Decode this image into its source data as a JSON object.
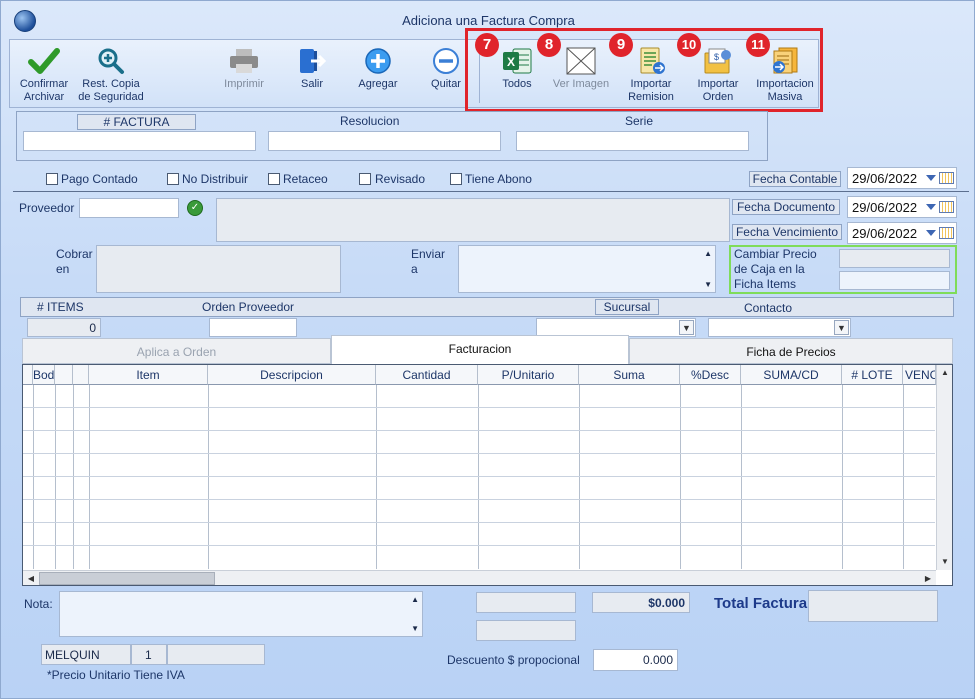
{
  "window": {
    "title": "Adiciona una Factura Compra"
  },
  "toolbar": {
    "confirm": "Confirmar\nArchivar",
    "restore": "Rest. Copia\nde Seguridad",
    "print": "Imprimir",
    "exit": "Salir",
    "add": "Agregar",
    "remove": "Quitar",
    "excel": "Todos",
    "image": "Ver Imagen",
    "import_remision": "Importar\nRemision",
    "import_orden": "Importar\nOrden",
    "import_masiva": "Importacion\nMasiva",
    "badges": [
      "7",
      "8",
      "9",
      "10",
      "11"
    ],
    "highlight_color": "#e0242b"
  },
  "header": {
    "factura_label": "# FACTURA",
    "resolucion_label": "Resolucion",
    "serie_label": "Serie",
    "factura_value": "",
    "resolucion_value": "",
    "serie_value": ""
  },
  "checks": {
    "pago_contado": "Pago Contado",
    "no_distribuir": "No Distribuir",
    "retaceo": "Retaceo",
    "revisado": "Revisado",
    "tiene_abono": "Tiene Abono"
  },
  "dates": {
    "contable_label": "Fecha Contable",
    "contable_value": "29/06/2022",
    "documento_label": "Fecha Documento",
    "documento_value": "29/06/2022",
    "vencimiento_label": "Fecha Vencimiento",
    "vencimiento_value": "29/06/2022"
  },
  "proveedor": {
    "label": "Proveedor",
    "value": ""
  },
  "cobrar_label": "Cobrar\nen",
  "enviar_label": "Enviar\na",
  "cambiar_precio_label": "Cambiar Precio\nde Caja en la\nFicha Items",
  "info": {
    "items_label": "# ITEMS",
    "items_value": "0",
    "orden_label": "Orden Proveedor",
    "sucursal_label": "Sucursal",
    "contacto_label": "Contacto"
  },
  "tabs": [
    "Aplica a Orden",
    "Facturacion",
    "Ficha de Precios"
  ],
  "grid": {
    "columns": [
      "Bodega",
      "",
      "",
      "Item",
      "Descripcion",
      "Cantidad",
      "P/Unitario",
      "Suma",
      "%Desc",
      "SUMA/CD",
      "# LOTE",
      "VENCE"
    ],
    "rows": []
  },
  "footer": {
    "nota_label": "Nota:",
    "total_value": "$0.000",
    "total_label": "Total Factura",
    "user": "MELQUIN",
    "user_num": "1",
    "descuento_label": "Descuento $ propocional",
    "descuento_value": "0.000",
    "iva_note": "*Precio Unitario Tiene IVA"
  }
}
